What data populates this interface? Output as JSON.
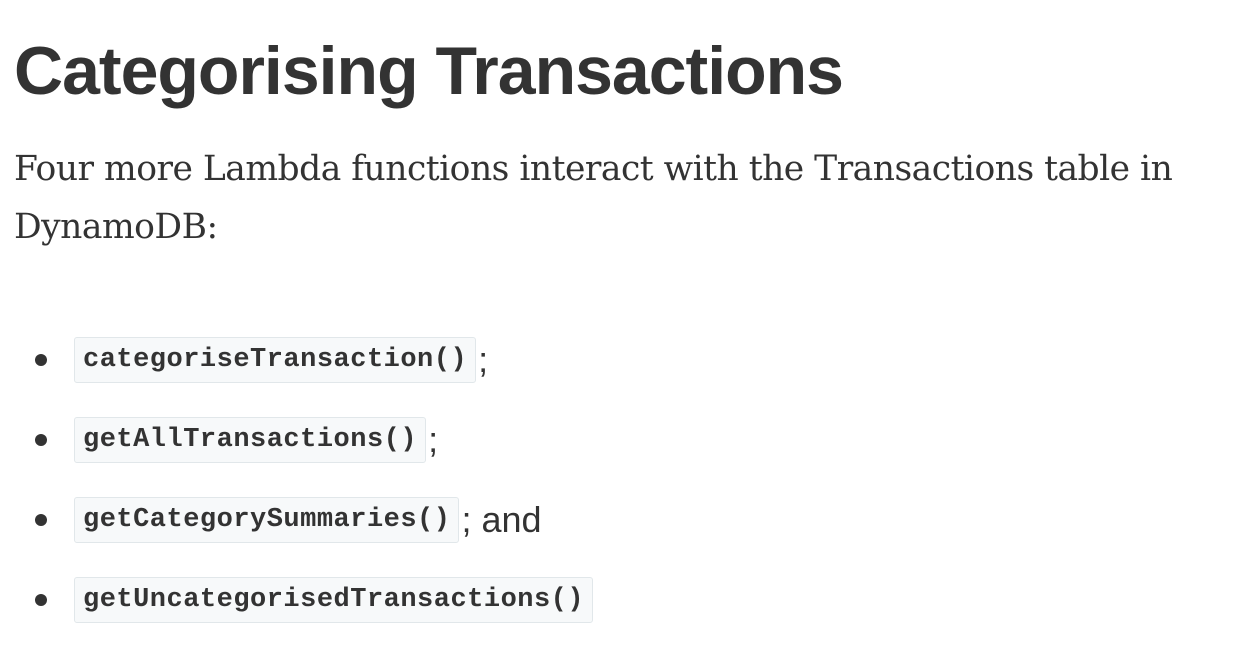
{
  "heading": "Categorising Transactions",
  "intro": "Four more Lambda functions interact with the Transactions table in DynamoDB:",
  "functions": [
    {
      "name": "categoriseTransaction()",
      "suffix": ";"
    },
    {
      "name": "getAllTransactions()",
      "suffix": ";"
    },
    {
      "name": "getCategorySummaries()",
      "suffix": "; and"
    },
    {
      "name": "getUncategorisedTransactions()",
      "suffix": ""
    }
  ],
  "colors": {
    "text": "#333333",
    "code_background": "#f7f9fa",
    "code_border": "#e1e7ea"
  }
}
